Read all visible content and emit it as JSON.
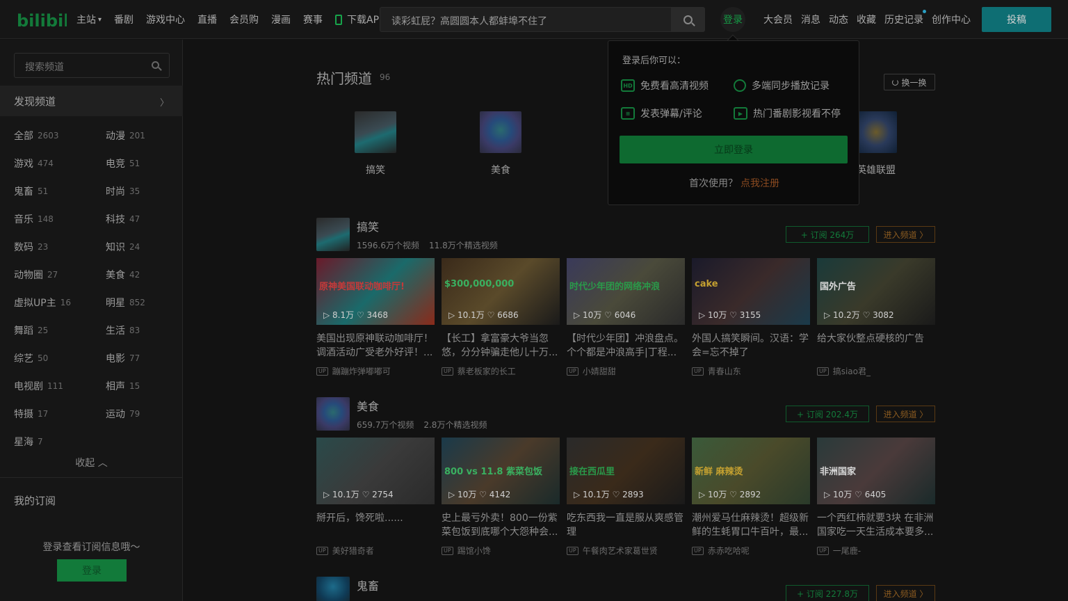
{
  "header": {
    "logo_text": "bilibili",
    "nav": [
      {
        "label": "主站",
        "caret": "▾"
      },
      {
        "label": "番剧"
      },
      {
        "label": "游戏中心"
      },
      {
        "label": "直播"
      },
      {
        "label": "会员购"
      },
      {
        "label": "漫画"
      },
      {
        "label": "赛事"
      },
      {
        "label": "下载APP"
      }
    ],
    "search_text": "读彩虹屁？高圆圆本人都蚌埠不住了",
    "login_label": "登录",
    "user_links": [
      "大会员",
      "消息",
      "动态",
      "收藏",
      "历史记录",
      "创作中心"
    ],
    "upload_label": "投稿"
  },
  "sidebar": {
    "search_placeholder": "搜索频道",
    "discover_label": "发现频道",
    "categories": [
      {
        "name": "全部",
        "count": "2603"
      },
      {
        "name": "动漫",
        "count": "201"
      },
      {
        "name": "游戏",
        "count": "474"
      },
      {
        "name": "电竞",
        "count": "51"
      },
      {
        "name": "鬼畜",
        "count": "51"
      },
      {
        "name": "时尚",
        "count": "35"
      },
      {
        "name": "音乐",
        "count": "148"
      },
      {
        "name": "科技",
        "count": "47"
      },
      {
        "name": "数码",
        "count": "23"
      },
      {
        "name": "知识",
        "count": "24"
      },
      {
        "name": "动物圈",
        "count": "27"
      },
      {
        "name": "美食",
        "count": "42"
      },
      {
        "name": "虚拟UP主",
        "count": "16"
      },
      {
        "name": "明星",
        "count": "852"
      },
      {
        "name": "舞蹈",
        "count": "25"
      },
      {
        "name": "生活",
        "count": "83"
      },
      {
        "name": "综艺",
        "count": "50"
      },
      {
        "name": "电影",
        "count": "77"
      },
      {
        "name": "电视剧",
        "count": "111"
      },
      {
        "name": "相声",
        "count": "15"
      },
      {
        "name": "特摄",
        "count": "17"
      },
      {
        "name": "运动",
        "count": "79"
      },
      {
        "name": "星海",
        "count": "7"
      }
    ],
    "collapse_label": "收起 ︿",
    "my_subscriptions": "我的订阅",
    "sub_hint": "登录查看订阅信息哦～",
    "login_label": "登录"
  },
  "main": {
    "hot_title": "热门频道",
    "hot_count": "96",
    "refresh_label": "换一换",
    "hot_channels": [
      {
        "label": "搞笑"
      },
      {
        "label": "美食"
      },
      {
        "label": "英雄联盟"
      }
    ],
    "sections": [
      {
        "name": "搞笑",
        "videos_count": "1596.6万个视频",
        "featured_count": "11.8万个精选视频",
        "subscribe_label": "+ 订阅 264万",
        "enter_label": "进入频道 〉",
        "videos": [
          {
            "title": "美国出现原神联动咖啡厅！调酒活动广受老外好评！...",
            "up": "蹦蹦炸弹嘟嘟可",
            "meta": "▷ 8.1万  ♡ 3468",
            "overlay": "原神美国联动咖啡厅!"
          },
          {
            "title": "【长工】拿富豪大爷当忽悠，分分钟骗走他儿十万...",
            "up": "蔡老板家的长工",
            "meta": "▷ 10.1万  ♡ 6686",
            "overlay": "$300,000,000"
          },
          {
            "title": "【时代少年团】冲浪盘点。个个都是冲浪高手|丁程...",
            "up": "小婧甜甜",
            "meta": "▷ 10万  ♡ 6046",
            "overlay": "时代少年团的网络冲浪"
          },
          {
            "title": "外国人搞笑瞬间。汉语：学会=忘不掉了",
            "up": "青春山东",
            "meta": "▷ 10万  ♡ 3155",
            "overlay": "cake"
          },
          {
            "title": "给大家伙整点硬核的广告",
            "up": "搞siao君_",
            "meta": "▷ 10.2万  ♡ 3082",
            "overlay": "国外广告"
          }
        ]
      },
      {
        "name": "美食",
        "videos_count": "659.7万个视频",
        "featured_count": "2.8万个精选视频",
        "subscribe_label": "+ 订阅 202.4万",
        "enter_label": "进入频道 〉",
        "videos": [
          {
            "title": "掰开后，馋死啦......",
            "up": "美好猎奇者",
            "meta": "▷ 10.1万  ♡ 2754",
            "overlay": ""
          },
          {
            "title": "史上最亏外卖！800一份紫菜包饭到底哪个大怨种会...",
            "up": "踢馆小馋",
            "meta": "▷ 10万  ♡ 4142",
            "overlay": "800 vs 11.8 紫菜包饭"
          },
          {
            "title": "吃东西我一直是服从爽感管理",
            "up": "午餐肉艺术家葛世贤",
            "meta": "▷ 10.1万  ♡ 2893",
            "overlay": "接在西瓜里"
          },
          {
            "title": "潮州爱马仕麻辣烫！超级新鲜的生蚝胃口牛百叶，最...",
            "up": "赤赤吃哈呢",
            "meta": "▷ 10万  ♡ 2892",
            "overlay": "新鲜 麻辣烫"
          },
          {
            "title": "一个西红柿就要3块 在非洲国家吃一天生活成本要多...",
            "up": "一尾鹿-",
            "meta": "▷ 10万  ♡ 6405",
            "overlay": "非洲国家"
          }
        ]
      },
      {
        "name": "鬼畜",
        "subscribe_label": "+ 订阅 227.8万",
        "enter_label": "进入频道 〉"
      }
    ]
  },
  "login_popup": {
    "heading": "登录后你可以：",
    "perks": [
      {
        "label": "免费看高清视频",
        "icon": "HD"
      },
      {
        "label": "多端同步播放记录",
        "icon": "clock-icon"
      },
      {
        "label": "发表弹幕/评论",
        "icon": "comment-icon"
      },
      {
        "label": "热门番剧影视看不停",
        "icon": "play-icon"
      }
    ],
    "login_button": "立即登录",
    "register_prompt": "首次使用？",
    "register_link": "点我注册"
  }
}
